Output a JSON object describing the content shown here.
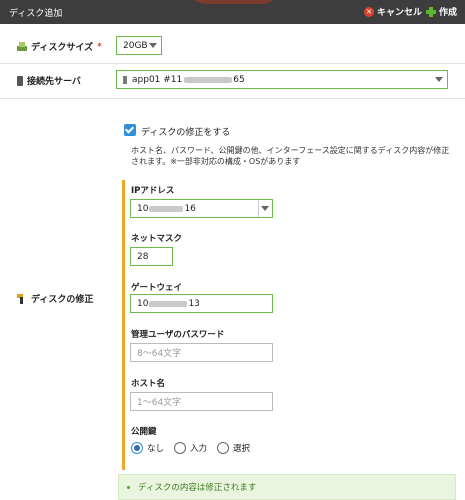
{
  "header": {
    "title": "ディスク追加",
    "cancel_label": "キャンセル",
    "create_label": "作成"
  },
  "disk_size": {
    "label": "ディスクサイズ",
    "required_mark": "*",
    "value": "20GB"
  },
  "server": {
    "label": "接続先サーバ",
    "value_prefix": "app01 #11",
    "value_suffix": "65"
  },
  "modify": {
    "row_label": "ディスクの修正",
    "checkbox_label": "ディスクの修正をする",
    "checked": true,
    "note": "ホスト名、パスワード、公開鍵の他、インターフェース設定に関するディスク内容が修正されます。※一部非対応の構成・OSがあります",
    "ip": {
      "label": "IPアドレス",
      "prefix": "10",
      "suffix": "16"
    },
    "netmask": {
      "label": "ネットマスク",
      "value": "28"
    },
    "gateway": {
      "label": "ゲートウェイ",
      "prefix": "10",
      "suffix": "13"
    },
    "password": {
      "label": "管理ユーザのパスワード",
      "placeholder": "8〜64文字"
    },
    "hostname": {
      "label": "ホスト名",
      "placeholder": "1〜64文字"
    },
    "pubkey": {
      "label": "公開鍵",
      "options": [
        "なし",
        "入力",
        "選択"
      ],
      "selected": "なし"
    },
    "notice": "ディスクの内容は修正されます"
  },
  "colors": {
    "header_bg": "#3d3d3d",
    "accent_green": "#6cba4a",
    "checkbox_blue": "#2f8fd8",
    "bar_orange": "#f0a52b",
    "notice_bg": "#eaf5df"
  }
}
